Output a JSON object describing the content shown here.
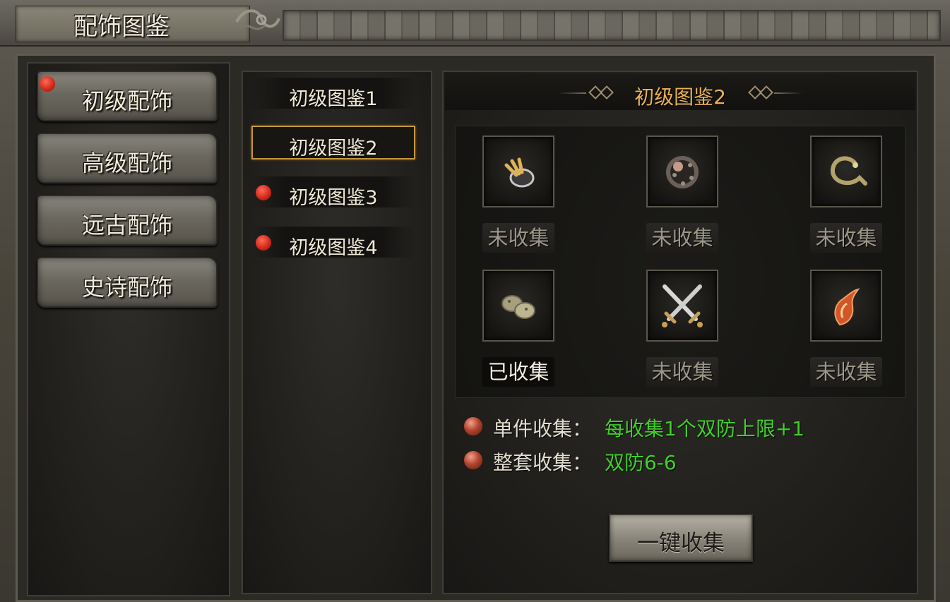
{
  "window": {
    "title": "配饰图鉴"
  },
  "categories": [
    {
      "label": "初级配饰",
      "active": true,
      "alert": true
    },
    {
      "label": "高级配饰",
      "active": false,
      "alert": false
    },
    {
      "label": "远古配饰",
      "active": false,
      "alert": false
    },
    {
      "label": "史诗配饰",
      "active": false,
      "alert": false
    }
  ],
  "books": [
    {
      "label": "初级图鉴1",
      "selected": false,
      "alert": false
    },
    {
      "label": "初级图鉴2",
      "selected": true,
      "alert": false
    },
    {
      "label": "初级图鉴3",
      "selected": false,
      "alert": true
    },
    {
      "label": "初级图鉴4",
      "selected": false,
      "alert": true
    }
  ],
  "detail": {
    "title": "初级图鉴2",
    "items": [
      {
        "icon": "claw-ring-icon",
        "status": "未收集",
        "collected": false
      },
      {
        "icon": "studded-ring-icon",
        "status": "未收集",
        "collected": false
      },
      {
        "icon": "serpent-ring-icon",
        "status": "未收集",
        "collected": false
      },
      {
        "icon": "stone-charm-icon",
        "status": "已收集",
        "collected": true
      },
      {
        "icon": "crossed-swords-icon",
        "status": "未收集",
        "collected": false
      },
      {
        "icon": "flame-horn-icon",
        "status": "未收集",
        "collected": false
      }
    ],
    "bonuses": [
      {
        "label": "单件收集：",
        "value": "每收集1个双防上限+1"
      },
      {
        "label": "整套收集：",
        "value": "双防6-6"
      }
    ],
    "collect_button": "一键收集"
  },
  "colors": {
    "accent_gold": "#e8b254",
    "bonus_green": "#3fd02a",
    "alert_red": "#d42a1c"
  }
}
